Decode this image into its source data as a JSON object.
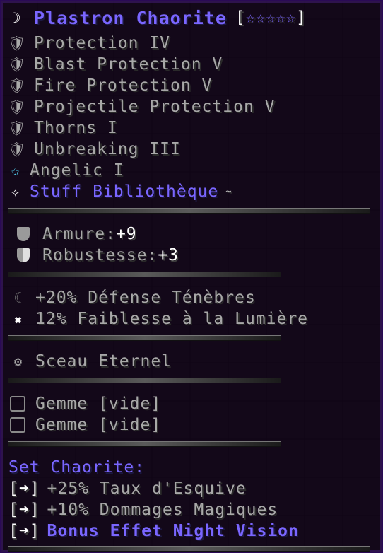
{
  "item": {
    "name": "Plastron Chaorite",
    "stars": "☆☆☆☆☆",
    "bracket_open": "[",
    "bracket_close": "]"
  },
  "enchantments": [
    {
      "label": "Protection IV",
      "icon": "armor-icon"
    },
    {
      "label": "Blast Protection V",
      "icon": "armor-icon"
    },
    {
      "label": "Fire Protection V",
      "icon": "armor-icon"
    },
    {
      "label": "Projectile Protection V",
      "icon": "armor-icon"
    },
    {
      "label": "Thorns I",
      "icon": "armor-icon"
    },
    {
      "label": "Unbreaking III",
      "icon": "armor-icon"
    }
  ],
  "angelic": {
    "label": "Angelic I",
    "icon": "star-icon"
  },
  "library": {
    "label": "Stuff Bibliothèque",
    "mark": "~",
    "icon": "diamond-icon"
  },
  "stats": [
    {
      "label": "Armure: ",
      "value": "+9"
    },
    {
      "label": "Robustesse: ",
      "value": "+3"
    }
  ],
  "effects": [
    {
      "label": "+20% Défense Ténèbres",
      "icon": "moon-icon"
    },
    {
      "label": "12% Faiblesse à la Lumière",
      "icon": "sun-icon"
    }
  ],
  "seal": {
    "label": "Sceau Eternel",
    "icon": "seal-icon"
  },
  "gems": [
    {
      "label": "Gemme [vide]"
    },
    {
      "label": "Gemme [vide]"
    }
  ],
  "set": {
    "title": "Set Chaorite:",
    "tag": "[➜]",
    "bonuses": [
      "+25% Taux d'Esquive",
      "+10% Dommages Magiques",
      "Bonus Effet Night Vision"
    ]
  },
  "colors": {
    "accent": "#7a66ff",
    "text": "#ffffff",
    "muted": "#a8a8a8",
    "background": "#10041a"
  }
}
